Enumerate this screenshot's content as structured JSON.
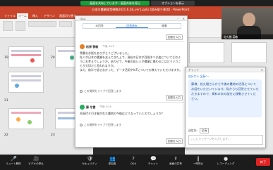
{
  "share_bar": {
    "status": "画面を共有しています・画面共有を停止",
    "options": "オプションを表示"
  },
  "ppt": {
    "window_title": "日本の農業経営戦略2021.6.28_ver1.pptx [読み取り専用] - PowerPoint",
    "tabs": [
      "ファイル",
      "ホーム",
      "挿入",
      "デザイン",
      "画面切り替え"
    ],
    "slide_numbers": [
      "19",
      "20",
      "21",
      "22",
      "23"
    ]
  },
  "qa": {
    "window_title": "Q&A",
    "tabs": [
      "未回答",
      "回答済み",
      "破棄"
    ],
    "reply_label": "回答を入力",
    "questions": [
      {
        "name": "松原 雅敏",
        "time": "午後 3:13",
        "body": "貴重なお話をありがとうございました。\n先人が日本の農業を支えてきた上で、現在の日本が目指すべき姿についてどのようにお考えでしょうか。あわせて、今後の若い人が農業に携わるにはどういうことが大切だと思われますか。\nまだ、前半で話せなかった、データ活用やIoTについても教えていただけますか。",
        "hint": "この質問をライブで回答します"
      },
      {
        "name": "藤 冬雪",
        "time": "午後 3:29",
        "body": "先祖代々引き継がれた農地の今後はどうなっていくのでしょうか？",
        "hint": "この質問をライブで回答します"
      }
    ]
  },
  "chat": {
    "title": "チャット",
    "sender": "自分から 全員へ:",
    "message": "藤様、佐久間さんから今後の農地の活用についてお話をいただいています。私からも回答させていただきますので、資料の次の部分に移動させてください。",
    "send_to_label": "送信先:",
    "send_to_value": "全員",
    "input_placeholder": "ここにメッセージを入力します..."
  },
  "cam": {
    "name": "佐久間 英敏"
  },
  "toolbar": {
    "items": [
      {
        "label": "ミュート解除",
        "icon": "microphone-icon",
        "glyph": "🎤"
      },
      {
        "label": "ビデオの停止",
        "icon": "video-icon",
        "glyph": "🎥"
      },
      {
        "label": "セキュリティ",
        "icon": "shield-icon",
        "glyph": "🛡"
      },
      {
        "label": "参加者",
        "icon": "participants-icon",
        "glyph": "👥"
      },
      {
        "label": "Q&A",
        "icon": "qa-icon",
        "glyph": "?"
      },
      {
        "label": "チャット",
        "icon": "chat-icon",
        "glyph": "💬"
      },
      {
        "label": "画面の共有",
        "icon": "share-screen-icon",
        "glyph": "⇪"
      },
      {
        "label": "一時停止",
        "icon": "pause-icon",
        "glyph": "‖"
      },
      {
        "label": "レコーディング",
        "icon": "record-icon",
        "glyph": "●"
      }
    ],
    "end_label": "終了"
  },
  "colors": {
    "ppt_accent": "#c8442a",
    "zoom_blue": "#1f6fd1",
    "share_green": "#1d9b3a",
    "end_red": "#e02424"
  }
}
